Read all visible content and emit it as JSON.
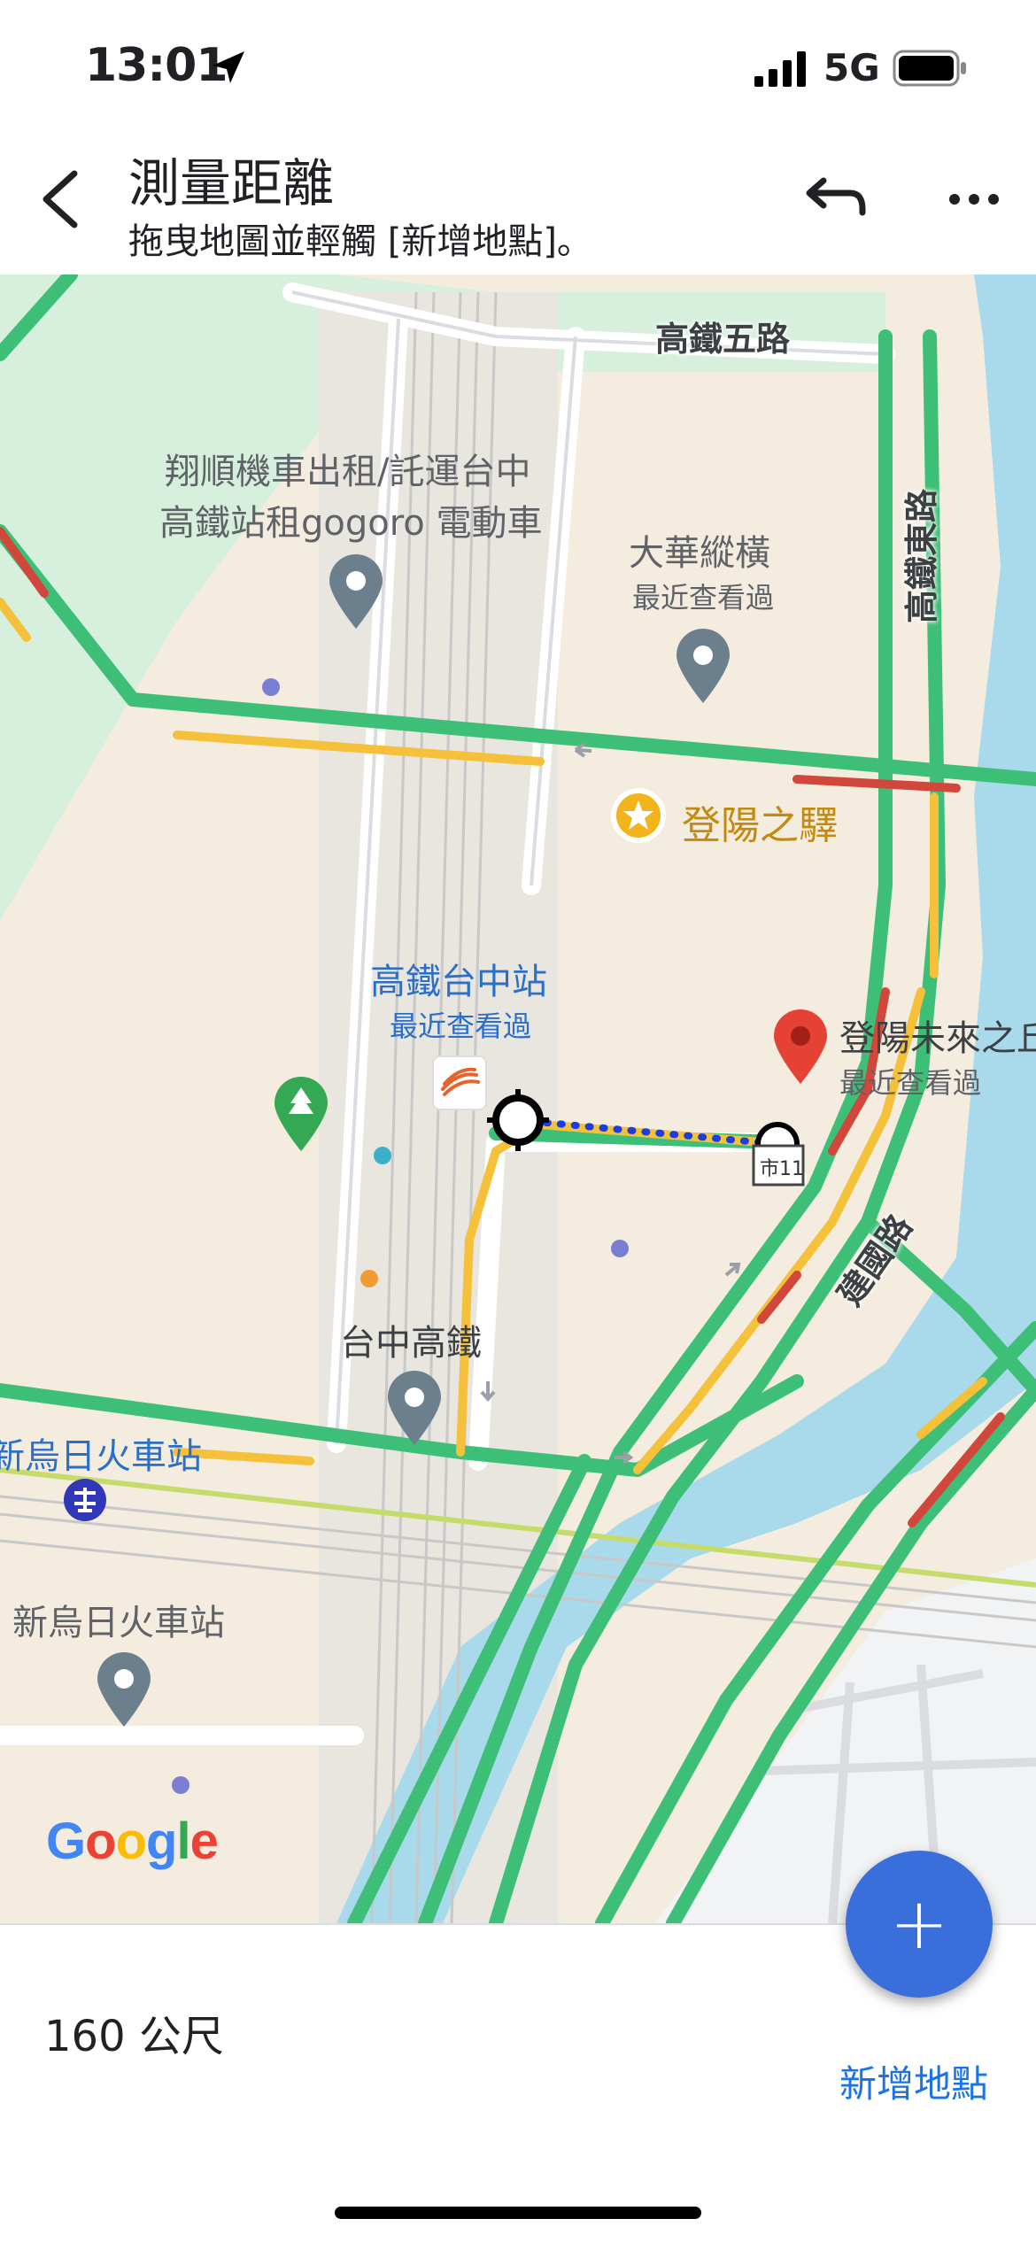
{
  "status_bar": {
    "time": "13:01",
    "network": "5G",
    "icons": [
      "location-arrow-icon",
      "signal-bars-icon",
      "battery-icon"
    ]
  },
  "header": {
    "title": "測量距離",
    "subtitle": "拖曳地圖並輕觸 [新增地點]。",
    "icons": [
      "back-arrow-icon",
      "undo-icon",
      "more-icon"
    ]
  },
  "map": {
    "labels": {
      "road_top": "高鐵五路",
      "road_right": "高鐵東路",
      "road_jianguo": "建國路",
      "poi_scooter_line1": "翔順機車出租/託運台中",
      "poi_scooter_line2": "高鐵站租gogoro 電動車",
      "poi_dahua": "大華縱橫",
      "poi_dahua_sub": "最近查看過",
      "poi_dengyang_station": "登陽之驛",
      "poi_hsr_station": "高鐵台中站",
      "poi_hsr_station_sub": "最近查看過",
      "poi_dengyang_future": "登陽未來之丘",
      "poi_dengyang_future_sub": "最近查看過",
      "poi_taichung_hsr": "台中高鐵",
      "poi_xinwuri_rail_top": "新烏日火車站",
      "poi_xinwuri_rail_bottom": "新烏日火車站",
      "road_shield": "市11",
      "logo": "Google"
    },
    "colors": {
      "land": "#f4ecdf",
      "park": "#d6f0dd",
      "water": "#a8daeb",
      "road": "#ffffff",
      "traffic_green": "#3ebf78",
      "traffic_yellow": "#f5c13a",
      "traffic_red": "#d2473b",
      "measure_line": "#1a3ee0",
      "marker_red": "#e54235",
      "marker_gray": "#6b7f8c",
      "accent_blue": "#1a73e8"
    }
  },
  "bottom": {
    "distance": "160 公尺",
    "add_place_label": "新增地點",
    "add_button_glyph": "+"
  }
}
